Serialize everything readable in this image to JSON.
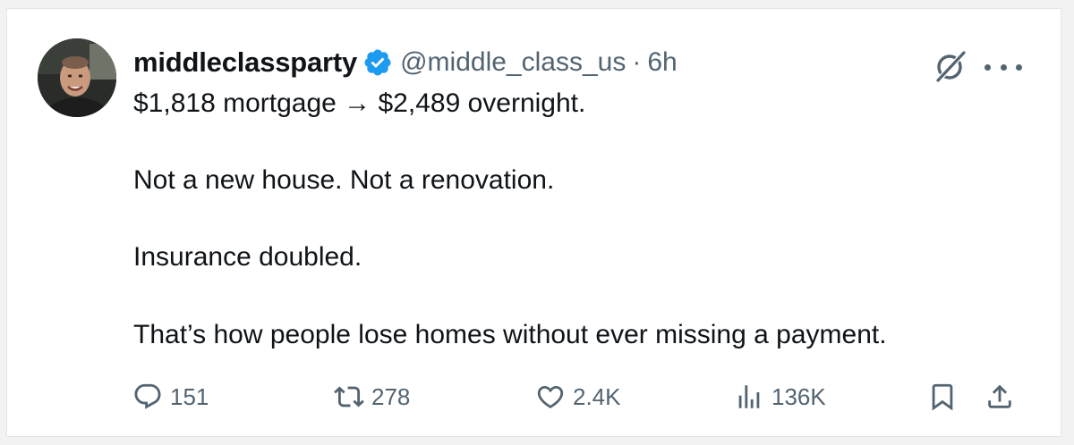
{
  "tweet": {
    "author_name": "middleclassparty",
    "handle": "@middle_class_us",
    "separator": "·",
    "time": "6h",
    "lines": [
      "$1,818 mortgage → $2,489 overnight.",
      "Not a new house. Not a renovation.",
      "Insurance doubled.",
      "That’s how people lose homes without ever missing a payment."
    ]
  },
  "actions": {
    "replies": "151",
    "retweets": "278",
    "likes": "2.4K",
    "views": "136K"
  },
  "icons": {
    "verified": "verified-badge-icon",
    "grok": "grok-icon",
    "more": "more-icon",
    "reply": "reply-icon",
    "retweet": "retweet-icon",
    "like": "heart-icon",
    "views": "views-icon",
    "bookmark": "bookmark-icon",
    "share": "share-icon"
  },
  "colors": {
    "text": "#0f1419",
    "secondary": "#536471",
    "verified": "#1d9bf0",
    "background": "#ffffff"
  }
}
